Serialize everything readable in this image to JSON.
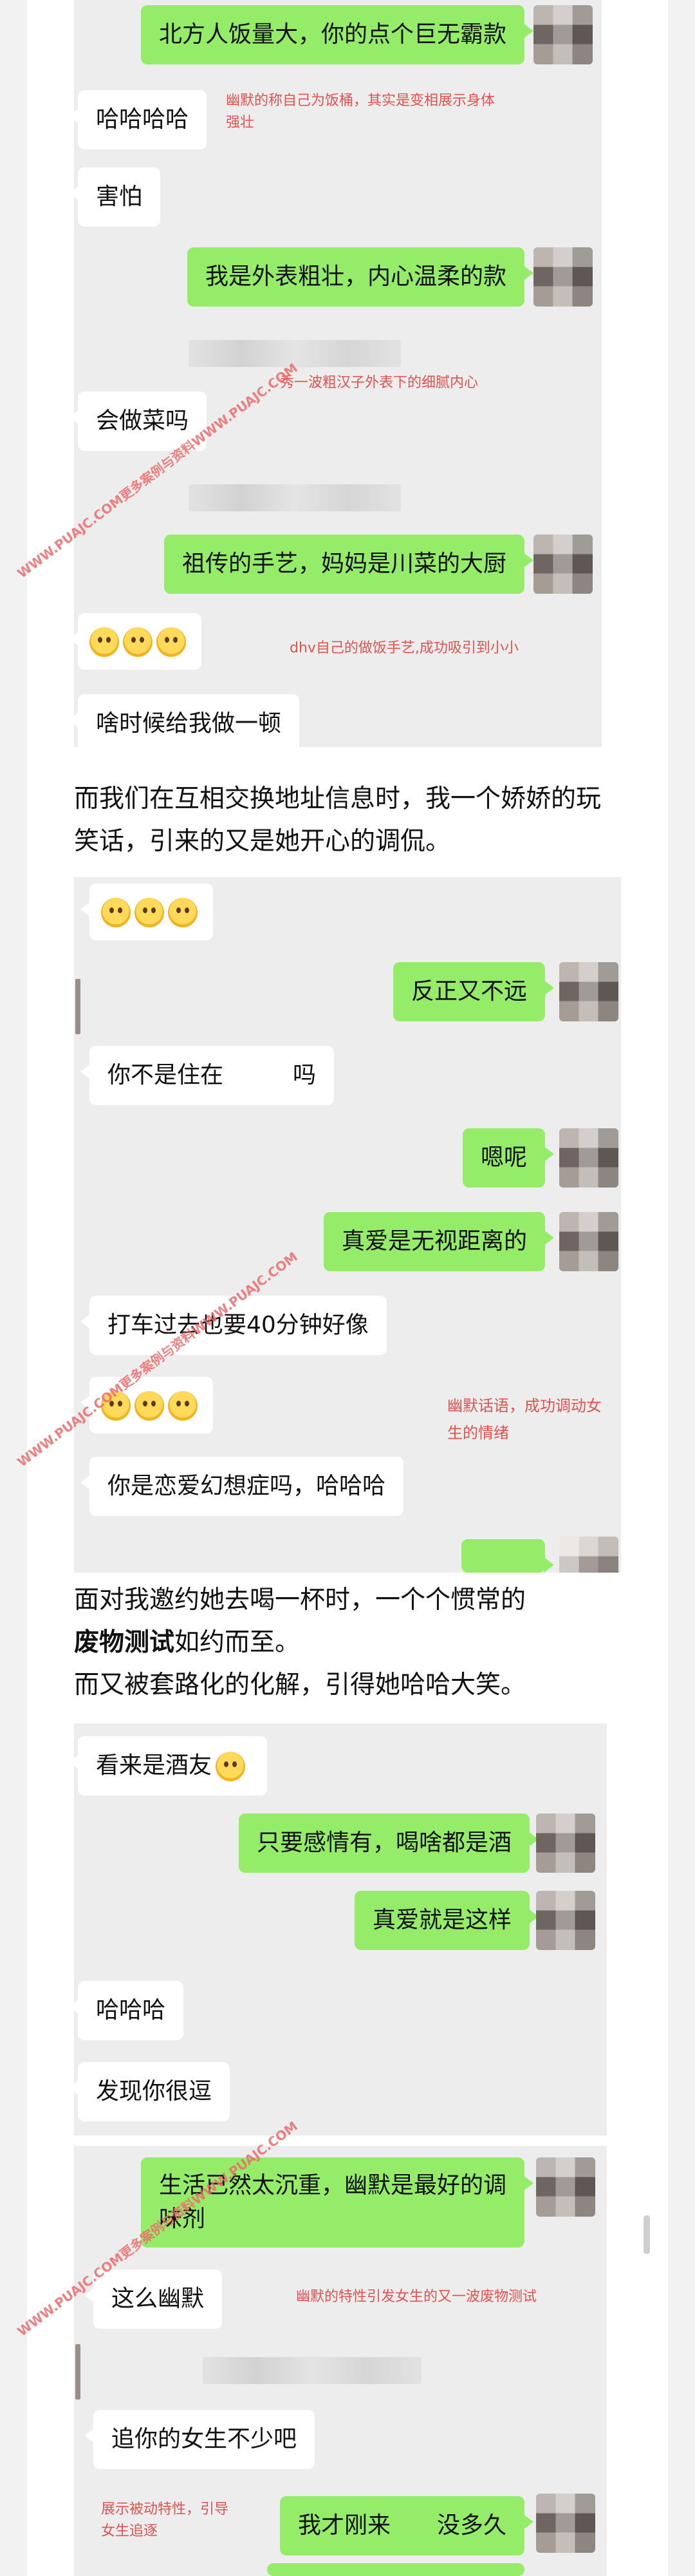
{
  "watermark": "WWW.PUAJC.COM更多案例与资料WWW.PUAJC.COM",
  "screenshot1": {
    "messages": [
      {
        "side": "right",
        "text": "北方人饭量大，你的点个巨无霸款"
      },
      {
        "side": "left",
        "text": "哈哈哈哈"
      },
      {
        "side": "left",
        "text": "害怕"
      },
      {
        "side": "right",
        "text": "我是外表粗壮，内心温柔的款"
      },
      {
        "side": "left",
        "text": "会做菜吗"
      },
      {
        "side": "right",
        "text": "祖传的手艺，妈妈是川菜的大厨"
      },
      {
        "side": "left",
        "text": "啥时候给我做一顿"
      }
    ],
    "notes": {
      "n1": "幽默的称自己为饭桶，其实是变相展示身体强壮",
      "n2": "秀一波粗汉子外表下的细腻内心",
      "n3": "dhv自己的做饭手艺,成功吸引到小小"
    }
  },
  "paragraph1": "而我们在互相交换地址信息时，我一个娇娇的玩笑话，引来的又是她开心的调侃。",
  "screenshot2": {
    "messages": [
      {
        "side": "right",
        "text": "反正又不远"
      },
      {
        "side": "left",
        "text": "你不是住在   吗"
      },
      {
        "side": "right",
        "text": "嗯呢"
      },
      {
        "side": "right",
        "text": "真爱是无视距离的"
      },
      {
        "side": "left",
        "text": "打车过去也要40分钟好像"
      },
      {
        "side": "left",
        "text": "你是恋爱幻想症吗，哈哈哈"
      }
    ],
    "notes": {
      "n1": "幽默话语，成功调动女生的情绪"
    }
  },
  "paragraph2": {
    "line1": "面对我邀约她去喝一杯时，一个个惯常的",
    "bold": "废物测试",
    "after_bold": "如约而至。",
    "line3": "而又被套路化的化解，引得她哈哈大笑。"
  },
  "screenshot3": {
    "messages": [
      {
        "side": "left",
        "text": "看来是酒友"
      },
      {
        "side": "right",
        "text": "只要感情有，喝啥都是酒"
      },
      {
        "side": "right",
        "text": "真爱就是这样"
      },
      {
        "side": "left",
        "text": "哈哈哈"
      },
      {
        "side": "left",
        "text": "发现你很逗"
      }
    ]
  },
  "screenshot4": {
    "messages": [
      {
        "side": "right",
        "text": "生活已然太沉重，幽默是最好的调味剂"
      },
      {
        "side": "left",
        "text": "这么幽默"
      },
      {
        "side": "left",
        "text": "追你的女生不少吧"
      },
      {
        "side": "right",
        "text": "我才刚来　　没多久"
      }
    ],
    "notes": {
      "n1": "幽默的特性引发女生的又一波废物测试",
      "n2": "展示被动特性，引导女生追逐"
    }
  }
}
